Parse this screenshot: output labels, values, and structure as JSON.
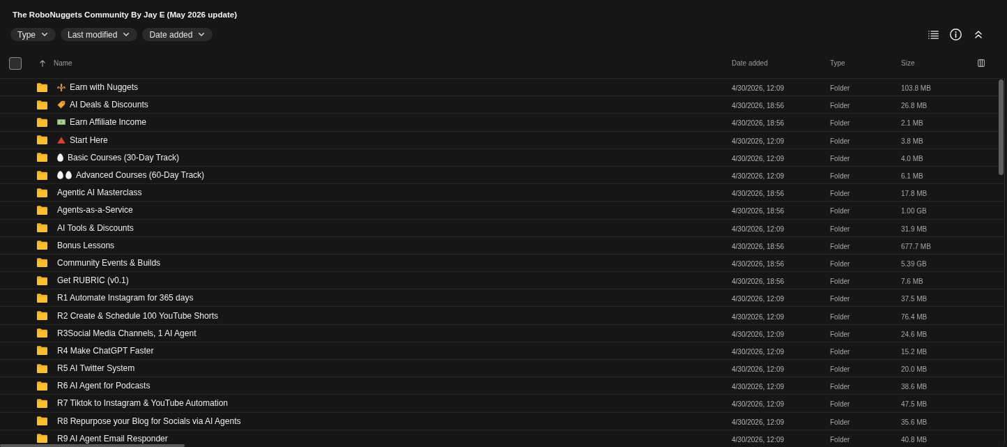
{
  "window": {
    "title": "The RoboNuggets Community By Jay E (May 2026 update)"
  },
  "filters": [
    {
      "label": "Type"
    },
    {
      "label": "Last modified"
    },
    {
      "label": "Date added"
    }
  ],
  "table": {
    "select_all": {
      "checked": false
    },
    "columns": [
      {
        "label": "Name",
        "sort_ascending": true
      },
      {
        "label": "Date added"
      },
      {
        "label": "Type"
      },
      {
        "label": "Size"
      }
    ],
    "rows": [
      {
        "emojis": [
          {
            "kind": "fleur-de-lis"
          }
        ],
        "name": "Earn with Nuggets",
        "date_added": "4/30/2026, 12:09",
        "type": "Folder",
        "size": "103.8 MB"
      },
      {
        "emojis": [
          {
            "kind": "tag"
          }
        ],
        "name": "AI Deals & Discounts",
        "date_added": "4/30/2026, 18:56",
        "type": "Folder",
        "size": "26.8 MB"
      },
      {
        "emojis": [
          {
            "kind": "banknote"
          }
        ],
        "name": "Earn Affiliate Income",
        "date_added": "4/30/2026, 18:56",
        "type": "Folder",
        "size": "2.1 MB"
      },
      {
        "emojis": [
          {
            "kind": "triangle"
          }
        ],
        "name": "Start Here",
        "date_added": "4/30/2026, 12:09",
        "type": "Folder",
        "size": "3.8 MB"
      },
      {
        "emojis": [
          {
            "kind": "egg"
          }
        ],
        "name": "Basic Courses (30-Day Track)",
        "date_added": "4/30/2026, 12:09",
        "type": "Folder",
        "size": "4.0 MB"
      },
      {
        "emojis": [
          {
            "kind": "egg"
          },
          {
            "kind": "egg"
          }
        ],
        "name": "Advanced Courses (60-Day Track)",
        "date_added": "4/30/2026, 12:09",
        "type": "Folder",
        "size": "6.1 MB"
      },
      {
        "name": "Agentic AI Masterclass",
        "date_added": "4/30/2026, 18:56",
        "type": "Folder",
        "size": "17.8 MB"
      },
      {
        "name": "Agents-as-a-Service",
        "date_added": "4/30/2026, 18:56",
        "type": "Folder",
        "size": "1.00 GB"
      },
      {
        "name": "AI Tools & Discounts",
        "date_added": "4/30/2026, 12:09",
        "type": "Folder",
        "size": "31.9 MB"
      },
      {
        "name": "Bonus Lessons",
        "date_added": "4/30/2026, 18:56",
        "type": "Folder",
        "size": "677.7 MB"
      },
      {
        "name": "Community Events & Builds",
        "date_added": "4/30/2026, 18:56",
        "type": "Folder",
        "size": "5.39 GB"
      },
      {
        "name": "Get RUBRIC (v0.1)",
        "date_added": "4/30/2026, 18:56",
        "type": "Folder",
        "size": "7.6 MB"
      },
      {
        "name": "R1 Automate Instagram for 365 days",
        "date_added": "4/30/2026, 12:09",
        "type": "Folder",
        "size": "37.5 MB"
      },
      {
        "name": "R2 Create & Schedule 100 YouTube Shorts",
        "date_added": "4/30/2026, 12:09",
        "type": "Folder",
        "size": "76.4 MB"
      },
      {
        "name": "R3Social Media Channels, 1 AI Agent",
        "date_added": "4/30/2026, 12:09",
        "type": "Folder",
        "size": "24.6 MB"
      },
      {
        "name": "R4 Make ChatGPT Faster",
        "date_added": "4/30/2026, 12:09",
        "type": "Folder",
        "size": "15.2 MB"
      },
      {
        "name": "R5 AI Twitter System",
        "date_added": "4/30/2026, 12:09",
        "type": "Folder",
        "size": "20.0 MB"
      },
      {
        "name": "R6 AI Agent for Podcasts",
        "date_added": "4/30/2026, 12:09",
        "type": "Folder",
        "size": "38.6 MB"
      },
      {
        "name": "R7 Tiktok to Instagram & YouTube Automation",
        "date_added": "4/30/2026, 12:09",
        "type": "Folder",
        "size": "47.5 MB"
      },
      {
        "name": "R8 Repurpose your Blog for Socials via AI Agents",
        "date_added": "4/30/2026, 12:09",
        "type": "Folder",
        "size": "35.6 MB"
      },
      {
        "name": "R9 AI Agent Email Responder",
        "date_added": "4/30/2026, 12:09",
        "type": "Folder",
        "size": "40.8 MB"
      }
    ]
  }
}
